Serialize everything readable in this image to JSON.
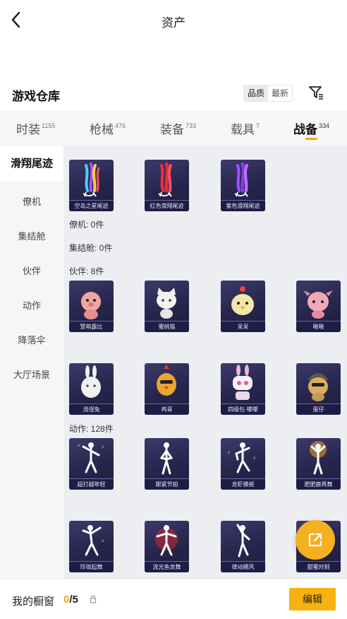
{
  "header": {
    "title": "资产"
  },
  "section": {
    "title": "游戏仓库",
    "sort_options": [
      "品质",
      "最新"
    ]
  },
  "tabs": [
    {
      "label": "时装",
      "count": "1155"
    },
    {
      "label": "枪械",
      "count": "476"
    },
    {
      "label": "装备",
      "count": "733"
    },
    {
      "label": "载具",
      "count": "7"
    },
    {
      "label": "战备",
      "count": "334"
    }
  ],
  "sidebar": {
    "items": [
      "滑翔尾迹",
      "僚机",
      "集结舱",
      "伙伴",
      "动作",
      "降落伞",
      "大厅场景"
    ]
  },
  "content": {
    "trails": [
      {
        "name": "空岛之星尾迹",
        "color": "rainbow"
      },
      {
        "name": "红色滑翔尾迹",
        "color": "#e0303a"
      },
      {
        "name": "紫色滑翔尾迹",
        "color": "#9a4ae0"
      }
    ],
    "wingman_label": "僚机: 0件",
    "rally_label": "集结舱: 0件",
    "partner_label": "伙伴: 8件",
    "partners": [
      {
        "name": "赞萌露比",
        "color": "#f0a7a0"
      },
      {
        "name": "蜜桃猫",
        "color": "#f4f2f0"
      },
      {
        "name": "呆呆",
        "color": "#f2e6a8"
      },
      {
        "name": "啾啾",
        "color": "#f1a9b8"
      },
      {
        "name": "流氓兔",
        "color": "#f0f0f0"
      },
      {
        "name": "鸡哥",
        "color": "#e8a530"
      },
      {
        "name": "四级包·嘟嘟",
        "color": "#f1b4d6"
      },
      {
        "name": "蛋仔",
        "color": "#d8b060"
      }
    ],
    "emote_label": "动作: 128件",
    "emotes": [
      {
        "name": "超打越年轻"
      },
      {
        "name": "跟紧节拍"
      },
      {
        "name": "龙虾摸摇"
      },
      {
        "name": "肥肥鹿再舞"
      },
      {
        "name": "玲珑起舞"
      },
      {
        "name": "流光鱼龙舞"
      },
      {
        "name": "律动飓风"
      },
      {
        "name": "甜蜜时刻"
      }
    ]
  },
  "bottom": {
    "label": "我的橱窗",
    "current": "0",
    "separator": "/",
    "max": "5",
    "edit_label": "编辑"
  },
  "colors": {
    "accent": "#f5a81a",
    "card_bg": "#2a284f"
  }
}
